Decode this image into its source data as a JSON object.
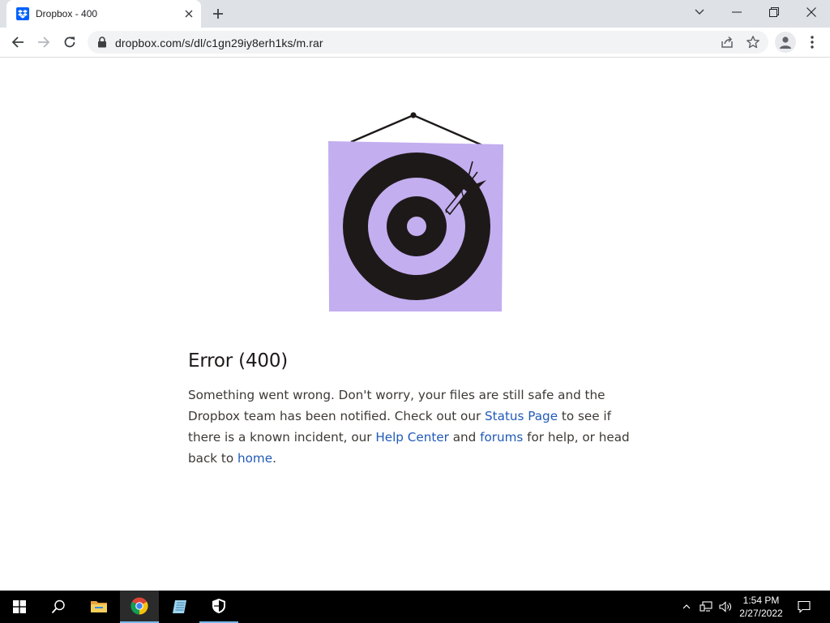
{
  "browser": {
    "tab": {
      "title": "Dropbox - 400",
      "favicon": "dropbox-icon"
    },
    "address_bar": {
      "url": "dropbox.com/s/dl/c1gn29iy8erh1ks/m.rar"
    }
  },
  "page": {
    "error_title": "Error (400)",
    "body": {
      "t1": "Something went wrong. Don't worry, your files are still safe and the Dropbox team has been notified. Check out our ",
      "link_status": "Status Page",
      "t2": " to see if there is a known incident, our ",
      "link_help": "Help Center",
      "t3": " and ",
      "link_forums": "forums",
      "t4": " for help, or head back to ",
      "link_home": "home",
      "t5": "."
    },
    "illustration": "dartboard-target"
  },
  "taskbar": {
    "time": "1:54 PM",
    "date": "2/27/2022"
  },
  "colors": {
    "link": "#1f5ab8",
    "target_bg": "#c3aef0",
    "favicon": "#0061fe"
  }
}
